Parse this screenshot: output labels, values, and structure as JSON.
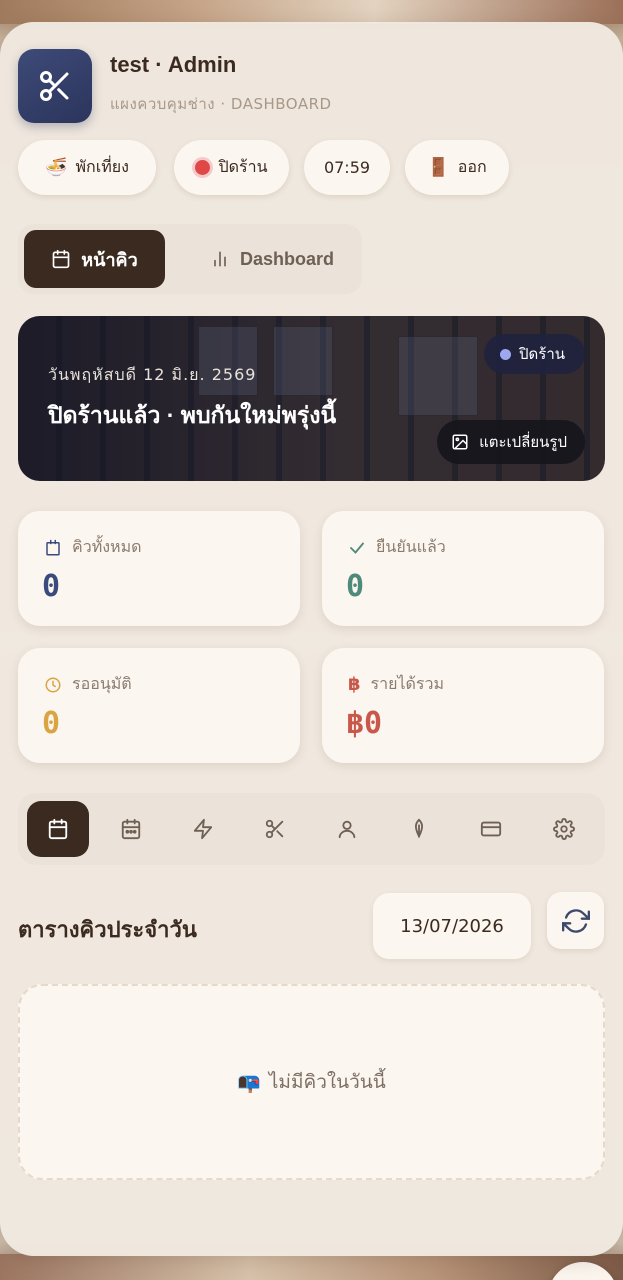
{
  "header": {
    "title": "test · Admin",
    "subtitle": "แผงควบคุมช่าง · DASHBOARD",
    "logo_icon": "scissors-icon"
  },
  "quick_actions": [
    {
      "emoji": "🍜",
      "label": "พักเที่ยง"
    },
    {
      "label": "ปิดร้าน"
    },
    {
      "label": "07:59"
    },
    {
      "emoji": "🚪",
      "label": "ออก"
    }
  ],
  "tabs": [
    {
      "label": "หน้าคิว",
      "icon": "calendar-icon",
      "active": true
    },
    {
      "label": "Dashboard",
      "icon": "bar-chart-icon",
      "active": false
    }
  ],
  "banner": {
    "date": "วันพฤหัสบดี 12 มิ.ย. 2569",
    "title": "ปิดร้านแล้ว · พบกันใหม่พรุ่งนี้",
    "status_badge": "ปิดร้าน",
    "change_image": "แตะเปลี่ยนรูป"
  },
  "stats": [
    {
      "label": "คิวทั้งหมด",
      "value": "0",
      "color": "#3a4a7c",
      "icon": "calendar-icon"
    },
    {
      "label": "ยืนยันแล้ว",
      "value": "0",
      "color": "#4e8a7a",
      "icon": "check-icon"
    },
    {
      "label": "รออนุมัติ",
      "value": "0",
      "color": "#d9a441",
      "icon": "clock-icon"
    },
    {
      "label": "รายได้รวม",
      "value": "฿0",
      "color": "#c9574a",
      "icon": "baht-icon"
    }
  ],
  "toolbar_icons": [
    "calendar-icon",
    "calendar-grid-icon",
    "lightning-icon",
    "scissors-icon",
    "user-icon",
    "leaf-icon",
    "card-icon",
    "gear-icon"
  ],
  "schedule": {
    "title": "ตารางคิวประจำวัน",
    "date": "13/07/2026"
  },
  "empty_state": {
    "emoji": "📭",
    "text": "ไม่มีคิวในวันนี้"
  },
  "colors": {
    "accent_dark": "#3a2a1f",
    "brand_navy": "#3e4a78",
    "status_closed": "#e04848"
  }
}
